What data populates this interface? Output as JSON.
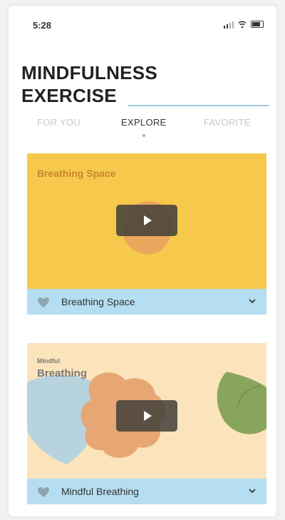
{
  "status_bar": {
    "time": "5:28"
  },
  "header": {
    "title_line1": "MINDFULNESS",
    "title_line2": "EXERCISE"
  },
  "tabs": [
    {
      "label": "FOR YOU",
      "active": false
    },
    {
      "label": "EXPLORE",
      "active": true
    },
    {
      "label": "FAVORITE",
      "active": false
    }
  ],
  "cards": [
    {
      "overlay_title": "Breathing Space",
      "footer_label": "Breathing Space",
      "bg_color": "#f6c94c",
      "text_color": "#c8842e"
    },
    {
      "overlay_title_small": "Mindful",
      "overlay_title": "Breathing",
      "footer_label": "Mindful Breathing",
      "bg_color": "#fbe3bc",
      "text_color": "#7a7a7a"
    }
  ],
  "colors": {
    "footer_bar": "#b6def2",
    "accent_line": "#9ec7e3",
    "play_button": "#423e3a"
  },
  "icons": [
    "signal-icon",
    "wifi-icon",
    "battery-icon",
    "play-icon",
    "heart-icon",
    "chevron-down-icon"
  ]
}
